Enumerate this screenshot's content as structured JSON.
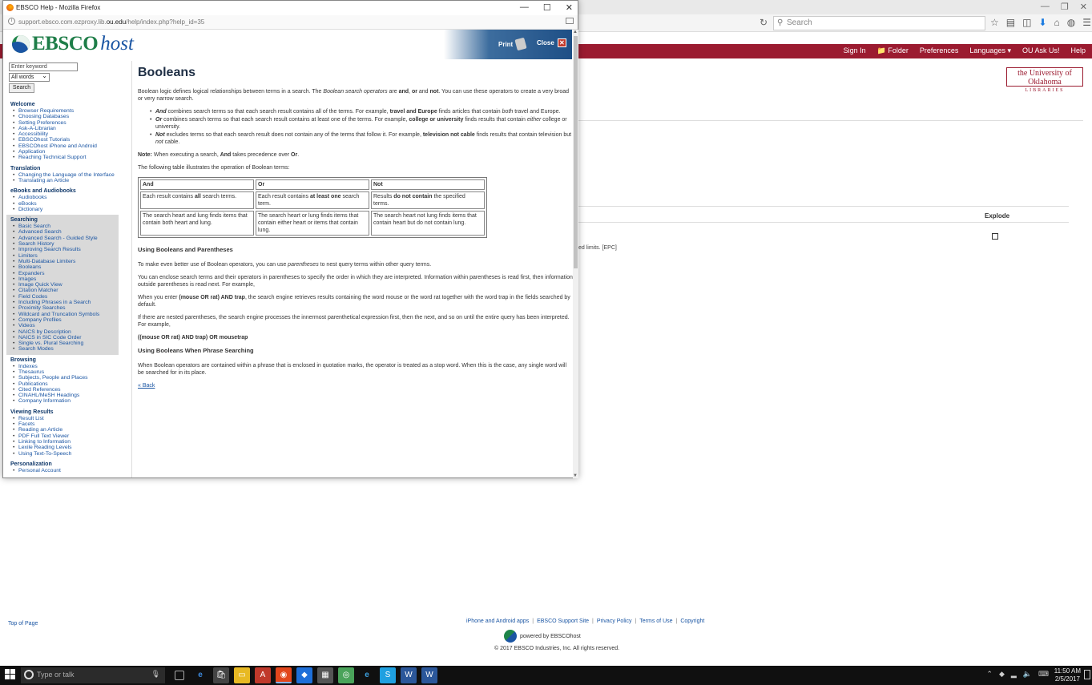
{
  "bg": {
    "search_placeholder": "Search",
    "toplinks": [
      "Sign In",
      "📁 Folder",
      "Preferences",
      "Languages ▾",
      "OU Ask Us!",
      "Help"
    ],
    "ou_logo_line1": "the University of Oklahoma",
    "ou_logo_line2": "LIBRARIES",
    "explode": "Explode",
    "limits_text": "ed limits. [EPC]",
    "footer_top": "Top of Page",
    "footer_links": [
      "iPhone and Android apps",
      "EBSCO Support Site",
      "Privacy Policy",
      "Terms of Use",
      "Copyright"
    ],
    "powered": "powered by EBSCOhost",
    "copyright": "© 2017 EBSCO Industries, Inc. All rights reserved."
  },
  "taskbar": {
    "search_placeholder": "Type or talk",
    "time": "11:50 AM",
    "date": "2/5/2017"
  },
  "popup": {
    "title": "EBSCO Help - Mozilla Firefox",
    "url_pre": "support.ebsco.com.ezproxy.lib.",
    "url_domain": "ou.edu",
    "url_post": "/help/index.php?help_id=35",
    "logo_ebsco": "EBSCO",
    "logo_host": "host",
    "print": "Print",
    "close": "Close"
  },
  "sidebar": {
    "keyword_placeholder": "Enter keyword",
    "select_value": "All words",
    "search_button": "Search",
    "groups": [
      {
        "head": "Welcome",
        "items": [
          "Browser Requirements",
          "Choosing Databases",
          "Setting Preferences",
          "Ask-A-Librarian",
          "Accessibility",
          "EBSCOhost Tutorials",
          "EBSCOhost iPhone and Android",
          "Application",
          "Reaching Technical Support"
        ]
      },
      {
        "head": "Translation",
        "items": [
          "Changing the Language of the Interface",
          "Translating an Article"
        ]
      },
      {
        "head": "eBooks and Audiobooks",
        "items": [
          "Audiobooks",
          "eBooks",
          "Dictionary"
        ]
      },
      {
        "head": "Searching",
        "items": [
          "Basic Search",
          "Advanced Search",
          "Advanced Search - Guided Style",
          "Search History",
          "Improving Search Results",
          "Limiters",
          "Multi-Database Limiters",
          "Booleans",
          "Expanders",
          "Images",
          "Image Quick View",
          "Citation Matcher",
          "Field Codes",
          "Including Phrases in a Search",
          "Proximity Searches",
          "Wildcard and Truncation Symbols",
          "Company Profiles",
          "Videos",
          "NAICS by Description",
          "NAICS in SIC Code Order",
          "Single vs. Plural Searching",
          "Search Modes"
        ]
      },
      {
        "head": "Browsing",
        "items": [
          "Indexes",
          "Thesaurus",
          "Subjects, People and Places",
          "Publications",
          "Cited References",
          "CINAHL/MeSH Headings",
          "Company Information"
        ]
      },
      {
        "head": "Viewing Results",
        "items": [
          "Result List",
          "Facets",
          "Reading an Article",
          "PDF Full Text Viewer",
          "Linking to Information",
          "Lexile Reading Levels",
          "Using Text-To-Speech"
        ]
      },
      {
        "head": "Personalization",
        "items": [
          "Personal Account"
        ]
      }
    ]
  },
  "content": {
    "title": "Booleans",
    "intro_1": "Boolean logic defines logical relationships between terms in a search. The ",
    "intro_em": "Boolean search operators",
    "intro_2": " are ",
    "intro_and": "and",
    "intro_or": "or",
    "intro_not": "not",
    "intro_3": ". You can use these operators to create a very broad or very narrow search.",
    "b1_op": "And",
    "b1_text": " combines search terms so that each search result contains all of the terms. For example, ",
    "b1_ex": "travel and Europe",
    "b1_text2": " finds articles that contain ",
    "b1_both": "both",
    "b1_text3": " travel and Europe.",
    "b2_op": "Or",
    "b2_text": " combines search terms so that each search result contains at least one of the terms. For example, ",
    "b2_ex": "college or university",
    "b2_text2": " finds results that contain ",
    "b2_either": "either",
    "b2_text3": " college or university.",
    "b3_op": "Not",
    "b3_text": " excludes terms so that each search result does not contain any of the terms that follow it. For example, ",
    "b3_ex": "television not cable",
    "b3_text2": " finds results that contain television but ",
    "b3_not": "not",
    "b3_text3": " cable.",
    "note_label": "Note:",
    "note_1": " When executing a search, ",
    "note_and": "And",
    "note_2": " takes precedence over ",
    "note_or": "Or",
    "note_3": ".",
    "table_intro": "The following table illustrates the operation of Boolean terms:",
    "table": {
      "headers": [
        "And",
        "Or",
        "Not"
      ],
      "r1c1a": "Each result contains ",
      "r1c1b": "all",
      "r1c1c": " search terms.",
      "r1c2a": "Each result contains ",
      "r1c2b": "at least one",
      "r1c2c": " search term.",
      "r1c3a": "Results ",
      "r1c3b": "do not contain",
      "r1c3c": " the specified terms.",
      "r2c1": "The search heart and lung finds items that contain both heart and lung.",
      "r2c2": "The search heart or lung finds items that contain either heart or items that contain lung.",
      "r2c3": "The search heart not lung finds items that contain heart but do not contain lung."
    },
    "h_parens": "Using Booleans and Parentheses",
    "p1_a": "To make even better use of Boolean operators, you can use ",
    "p1_em": "parentheses",
    "p1_b": " to nest query terms within other query terms.",
    "p2": "You can enclose search terms and their operators in parentheses to specify the order in which they are interpreted. Information within parentheses is read first, then information outside parentheses is read next. For example,",
    "p3_a": "When you enter ",
    "p3_b": "(mouse OR rat) AND trap",
    "p3_c": ", the search engine retrieves results containing the word mouse or the word rat together with the word trap in the fields searched by default.",
    "p4": "If there are nested parentheses, the search engine processes the innermost parenthetical expression first, then the next, and so on until the entire query has been interpreted. For example,",
    "p5": "((mouse OR rat) AND trap) OR mousetrap",
    "h_phrase": "Using Booleans When Phrase Searching",
    "p6": "When Boolean operators are contained within a phrase that is enclosed in quotation marks, the operator is treated as a stop word. When this is the case, any single word will be searched for in its place.",
    "back": "« Back"
  }
}
